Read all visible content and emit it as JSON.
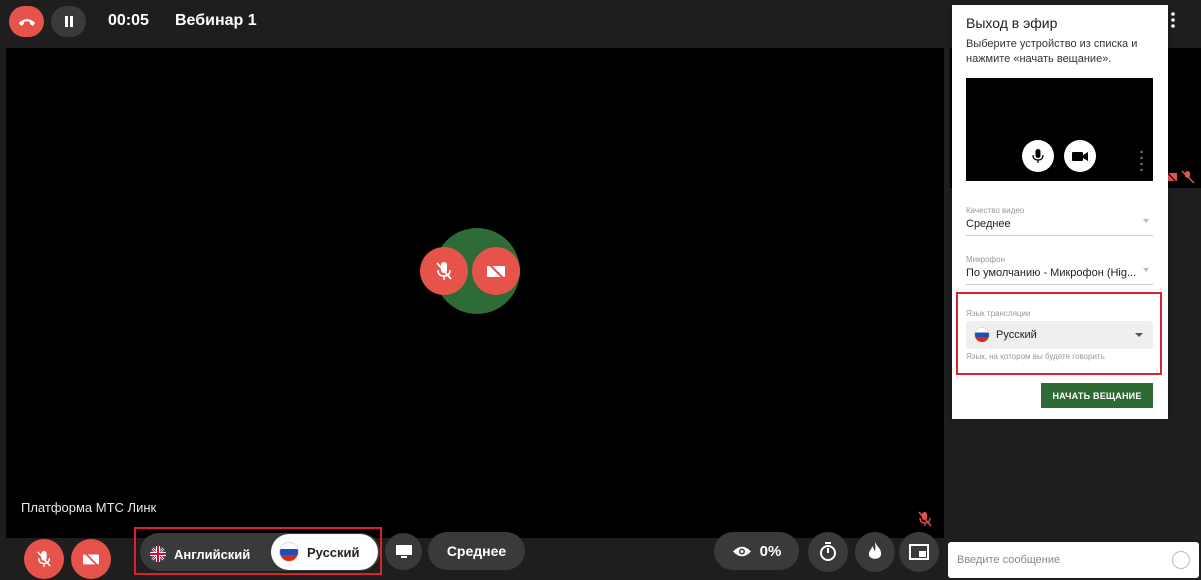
{
  "topbar": {
    "timer": "00:05",
    "title": "Вебинар 1"
  },
  "video": {
    "platform_label": "Платформа МТС Линк"
  },
  "bottombar": {
    "lang_english": "Английский",
    "lang_russian": "Русский",
    "quality": "Среднее",
    "viewers_percent": "0%"
  },
  "chat": {
    "placeholder": "Введите сообщение"
  },
  "broadcast_panel": {
    "title": "Выход в эфир",
    "description": "Выберите устройство из списка и нажмите «начать вещание».",
    "video_quality_label": "Качество видео",
    "video_quality_value": "Среднее",
    "microphone_label": "Микрофон",
    "microphone_value": "По умолчанию - Микрофон (Hig...",
    "translation_lang_label": "Язык трансляции",
    "translation_lang_value": "Русский",
    "translation_lang_hint": "Язык, на котором вы будете говорить",
    "start_button": "НАЧАТЬ ВЕЩАНИЕ"
  },
  "colors": {
    "danger": "#e5534b",
    "accent_green": "#2e6a33",
    "highlight_frame": "#d9232d"
  }
}
